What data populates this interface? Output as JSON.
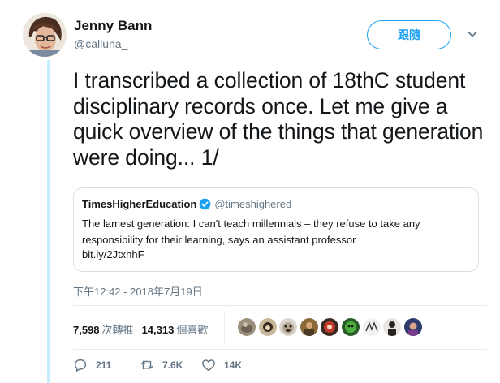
{
  "author": {
    "name": "Jenny Bann",
    "handle": "@calluna_"
  },
  "follow_label": "跟隨",
  "icons": {
    "menu": "chevron-down-icon",
    "verified": "verified-badge-icon",
    "reply": "reply-icon",
    "retweet": "retweet-icon",
    "like": "heart-icon"
  },
  "tweet": {
    "text": "I transcribed a collection of 18thC student disciplinary records once. Let me give a quick overview of the things that generation were doing... 1/",
    "timestamp": "下午12:42 - 2018年7月19日"
  },
  "quoted": {
    "name": "TimesHigherEducation",
    "handle": "@timeshighered",
    "text": "The lamest generation: I can't teach millennials – they refuse to take any responsibility for their learning, says an assistant professor",
    "link": "bit.ly/2JtxhhF"
  },
  "stats": {
    "retweets_count": "7,598",
    "retweets_label": "次轉推",
    "likes_count": "14,313",
    "likes_label": "個喜歡"
  },
  "actions": {
    "reply_count": "211",
    "retweet_count": "7.6K",
    "like_count": "14K"
  },
  "colors": {
    "accent": "#1da1f2",
    "text": "#14171a",
    "muted": "#657786",
    "thread_line": "#c4eefb",
    "border": "#e6ecf0"
  }
}
